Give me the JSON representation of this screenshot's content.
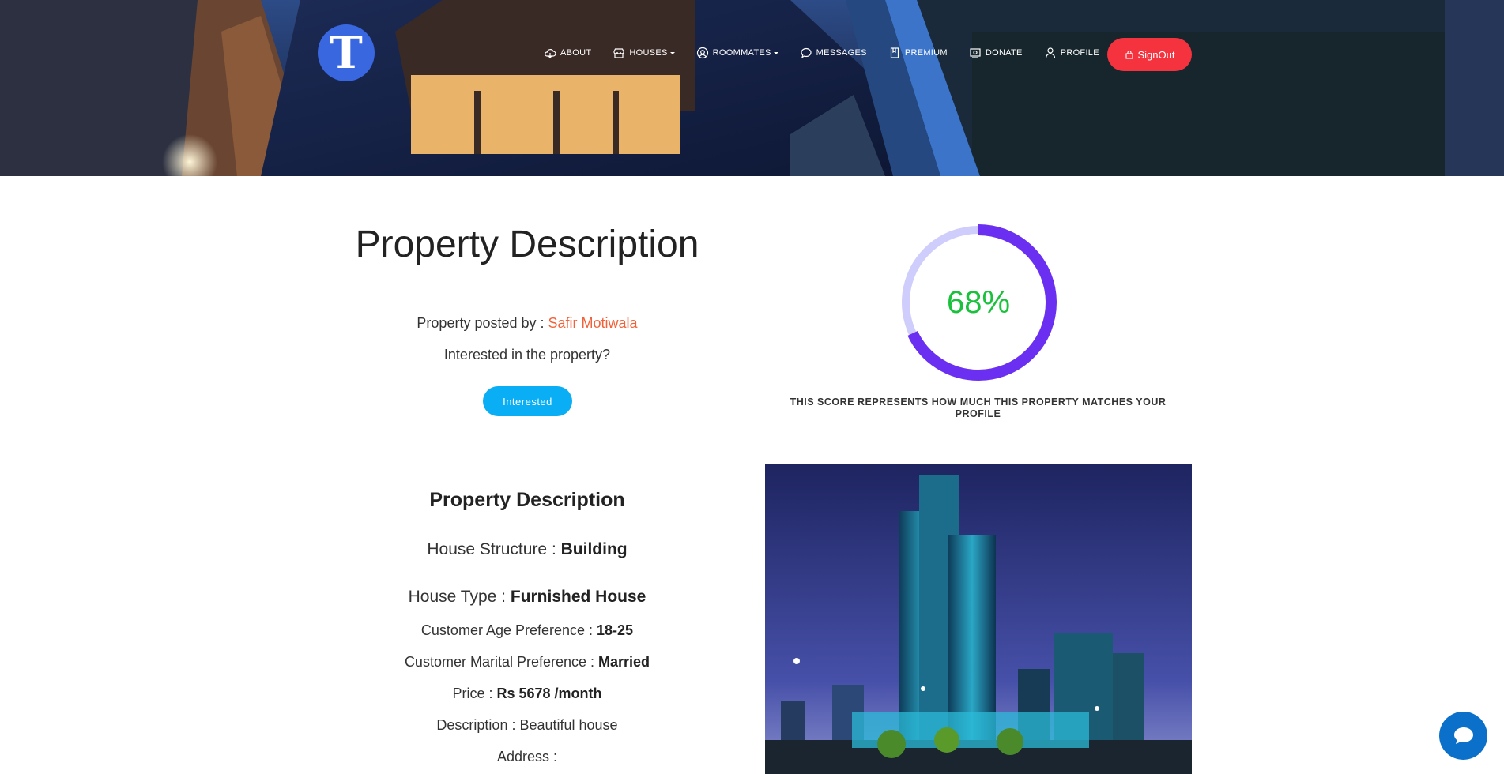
{
  "brand": {
    "logo_letter": "T"
  },
  "nav": {
    "items": [
      {
        "label": "ABOUT",
        "icon": "cloud-icon"
      },
      {
        "label": "HOUSES",
        "icon": "store-icon",
        "dropdown": true
      },
      {
        "label": "ROOMMATES",
        "icon": "user-circle-icon",
        "dropdown": true
      },
      {
        "label": "MESSAGES",
        "icon": "chat-bubble-icon"
      },
      {
        "label": "PREMIUM",
        "icon": "bookmark-icon"
      },
      {
        "label": "DONATE",
        "icon": "donate-icon"
      },
      {
        "label": "PROFILE",
        "icon": "person-icon"
      }
    ],
    "signout_label": "SignOut"
  },
  "property": {
    "title": "Property Description",
    "posted_by_label": "Property posted by : ",
    "posted_by_name": "Safir Motiwala",
    "interested_question": "Interested in the property?",
    "interested_button": "Interested"
  },
  "score": {
    "value_text": "68%",
    "value": 0.68,
    "caption": "THIS SCORE REPRESENTS HOW MUCH THIS PROPERTY MATCHES YOUR PROFILE",
    "colors": {
      "arc": "#6a2ff0",
      "track": "#cfcdfb",
      "text": "#1bc13d"
    }
  },
  "details": {
    "heading": "Property Description",
    "house_structure_label": "House Structure : ",
    "house_structure": "Building",
    "house_type_label": "House Type : ",
    "house_type": "Furnished House",
    "age_label": "Customer Age Preference : ",
    "age": "18-25",
    "marital_label": "Customer Marital Preference : ",
    "marital": "Married",
    "price_label": "Price : ",
    "price": "Rs 5678 /month",
    "description_label": "Description : ",
    "description": "Beautiful house",
    "address_label": "Address : ",
    "address": ""
  },
  "colors": {
    "signout": "#f5333f",
    "interested": "#0aaef5",
    "posted_name": "#f2623a",
    "chat": "#0a70c9",
    "logo": "#3867e0"
  }
}
